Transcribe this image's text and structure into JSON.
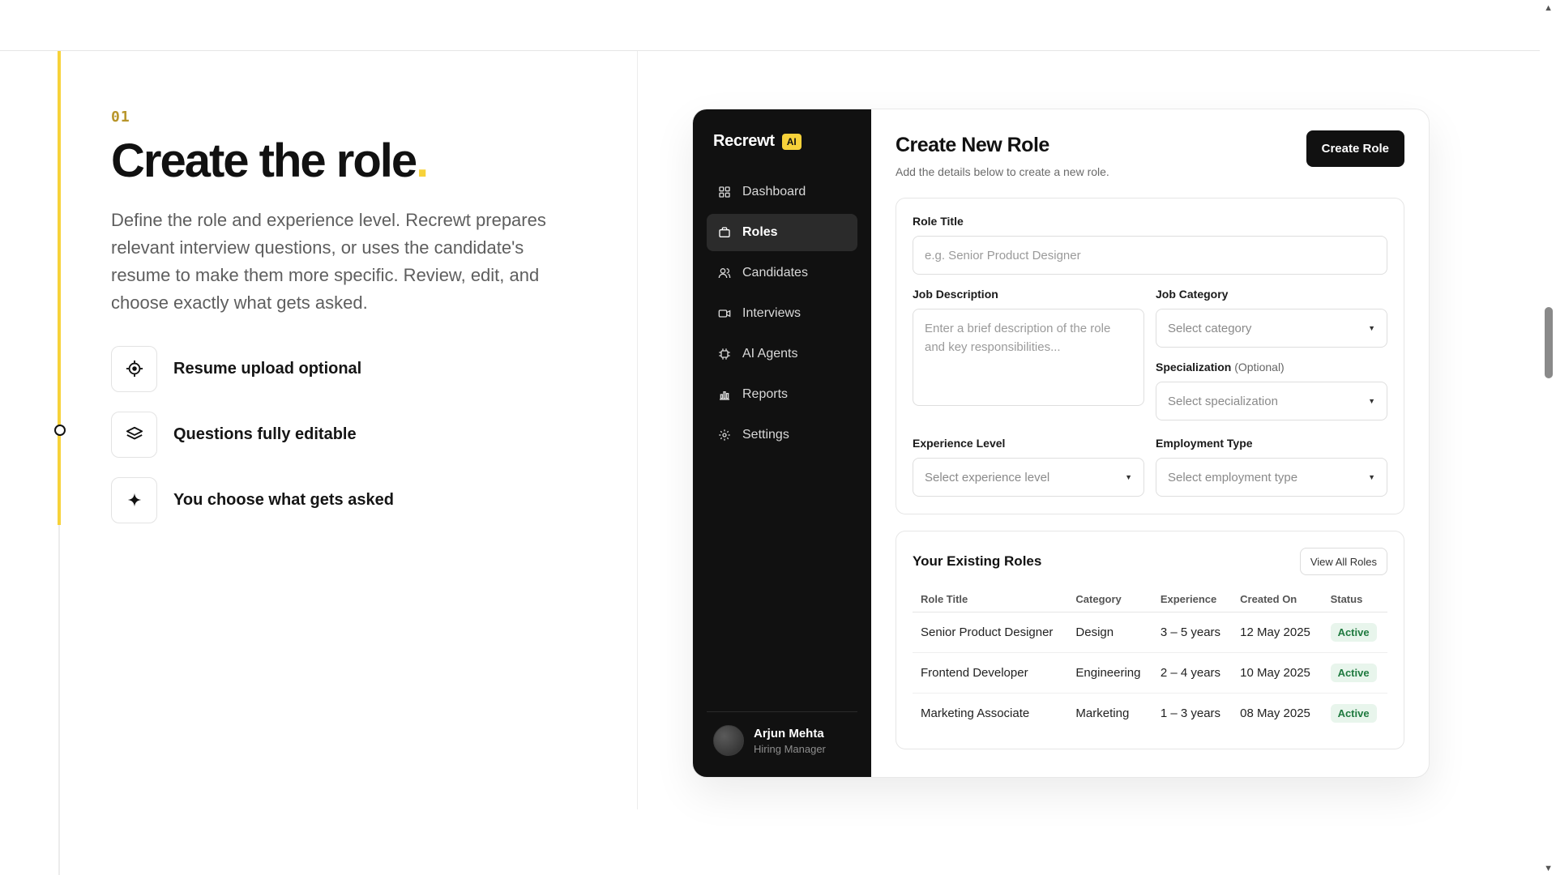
{
  "step": {
    "number": "01",
    "title": "Create the role",
    "title_dot": ".",
    "description": "Define the role and experience level. Recrewt prepares relevant interview questions, or uses the candidate's resume to make them more specific. Review, edit, and choose exactly what gets asked.",
    "features": [
      {
        "label": "Resume upload optional",
        "icon": "crosshair-icon"
      },
      {
        "label": "Questions fully editable",
        "icon": "layers-icon"
      },
      {
        "label": "You choose what gets asked",
        "icon": "sparkle-icon"
      }
    ]
  },
  "app": {
    "brand": "Recrewt",
    "brand_badge": "AI",
    "accent_color": "#f7d23a",
    "nav": [
      {
        "label": "Dashboard",
        "icon": "grid-icon",
        "active": false
      },
      {
        "label": "Roles",
        "icon": "briefcase-icon",
        "active": true
      },
      {
        "label": "Candidates",
        "icon": "users-icon",
        "active": false
      },
      {
        "label": "Interviews",
        "icon": "video-icon",
        "active": false
      },
      {
        "label": "AI Agents",
        "icon": "chip-icon",
        "active": false
      },
      {
        "label": "Reports",
        "icon": "bar-chart-icon",
        "active": false
      },
      {
        "label": "Settings",
        "icon": "gear-icon",
        "active": false
      }
    ],
    "user": {
      "name": "Arjun Mehta",
      "role": "Hiring Manager"
    }
  },
  "form": {
    "title": "Create New Role",
    "subtitle": "Add the details below to create a new role.",
    "create_button": "Create Role",
    "role_title": {
      "label": "Role Title",
      "placeholder": "e.g. Senior Product Designer"
    },
    "job_description": {
      "label": "Job Description",
      "placeholder": "Enter a brief description of the role and key responsibilities..."
    },
    "job_category": {
      "label": "Job Category",
      "placeholder": "Select category"
    },
    "specialization": {
      "label": "Specialization",
      "optional": "(Optional)",
      "placeholder": "Select specialization"
    },
    "experience_level": {
      "label": "Experience Level",
      "placeholder": "Select experience level"
    },
    "employment_type": {
      "label": "Employment Type",
      "placeholder": "Select employment type"
    }
  },
  "roles": {
    "title": "Your Existing Roles",
    "view_all": "View All Roles",
    "columns": [
      "Role Title",
      "Category",
      "Experience",
      "Created On",
      "Status"
    ],
    "rows": [
      [
        "Senior Product Designer",
        "Design",
        "3 – 5 years",
        "12 May 2025",
        "Active"
      ],
      [
        "Frontend Developer",
        "Engineering",
        "2 – 4 years",
        "10 May 2025",
        "Active"
      ],
      [
        "Marketing Associate",
        "Marketing",
        "1 – 3 years",
        "08 May 2025",
        "Active"
      ]
    ],
    "status_color": "#1f7a3f"
  }
}
